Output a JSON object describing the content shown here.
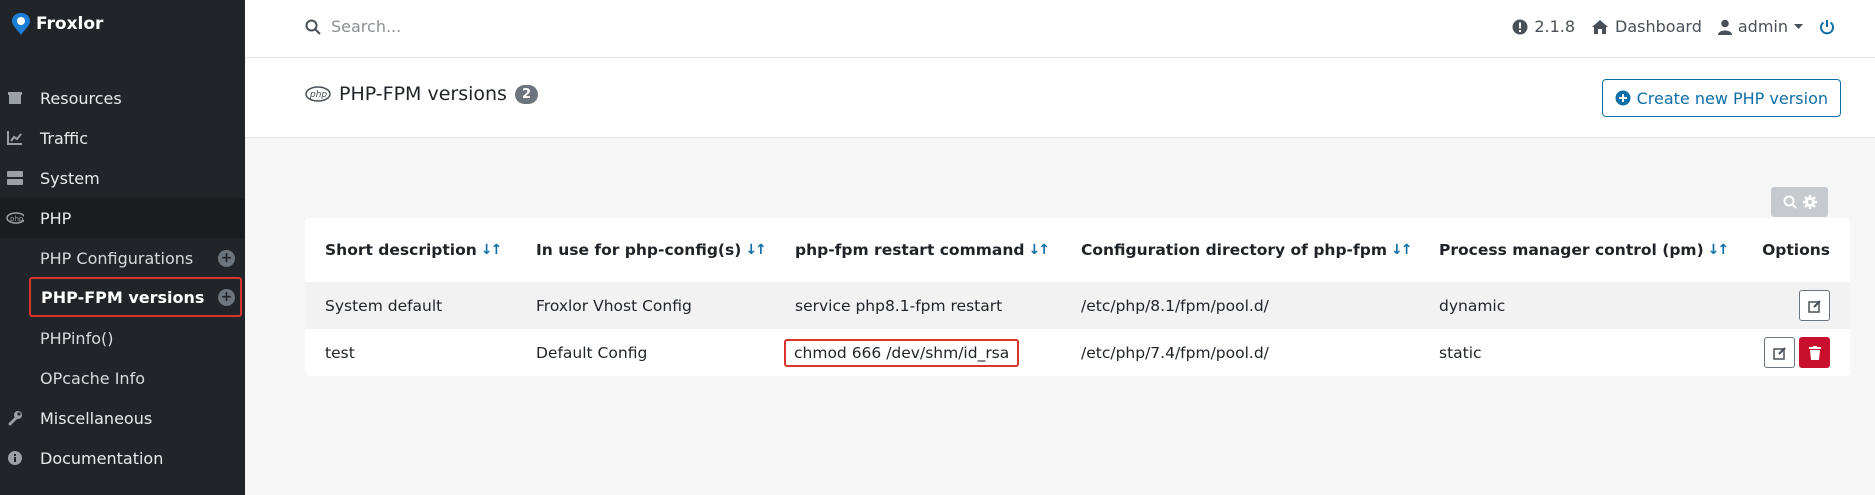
{
  "brand": {
    "name": "Froxlor"
  },
  "sidebar": {
    "items": [
      {
        "label": "Resources",
        "icon": "box-icon"
      },
      {
        "label": "Traffic",
        "icon": "chart-icon"
      },
      {
        "label": "System",
        "icon": "server-icon"
      },
      {
        "label": "PHP",
        "icon": "php-icon"
      },
      {
        "label": "Miscellaneous",
        "icon": "wrench-icon"
      },
      {
        "label": "Documentation",
        "icon": "info-icon"
      }
    ],
    "php_sub": [
      {
        "label": "PHP Configurations"
      },
      {
        "label": "PHP-FPM versions"
      },
      {
        "label": "PHPinfo()"
      },
      {
        "label": "OPcache Info"
      }
    ]
  },
  "topbar": {
    "search_placeholder": "Search...",
    "version": "2.1.8",
    "dashboard": "Dashboard",
    "user": "admin"
  },
  "header": {
    "title": "PHP-FPM versions",
    "count": "2",
    "create_label": "Create new PHP version"
  },
  "table": {
    "columns": [
      "Short description",
      "In use for php-config(s)",
      "php-fpm restart command",
      "Configuration directory of php-fpm",
      "Process manager control (pm)",
      "Options"
    ],
    "sort_glyph": "↓↑",
    "rows": [
      [
        "System default",
        "Froxlor Vhost Config",
        "service php8.1-fpm restart",
        "/etc/php/8.1/fpm/pool.d/",
        "dynamic"
      ],
      [
        "test",
        "Default Config",
        "chmod 666 /dev/shm/id_rsa",
        "/etc/php/7.4/fpm/pool.d/",
        "static"
      ]
    ]
  },
  "colors": {
    "accent": "#0d6ea8",
    "danger": "#c8102e",
    "sidebar": "#212529",
    "highlight": "#d9342b"
  }
}
